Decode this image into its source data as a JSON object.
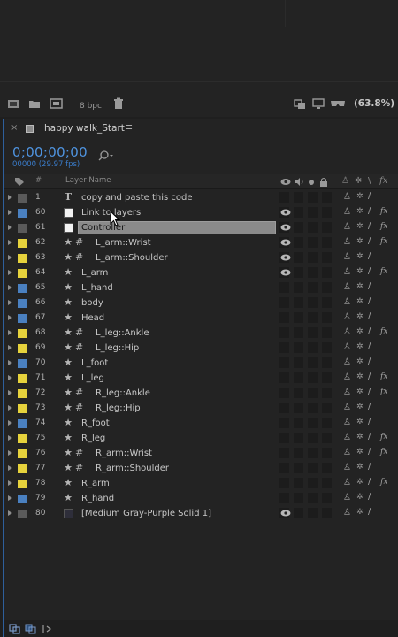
{
  "toolbar": {
    "bpc_label": "8 bpc",
    "zoom_label": "(63.8%)"
  },
  "comp_tab": {
    "close": "×",
    "name": "happy walk_Start",
    "menu": "≡"
  },
  "timecode": "0;00;00;00",
  "frame_info": "00000 (29.97 fps)",
  "columns": {
    "num": "#",
    "layer_name": "Layer Name"
  },
  "layers": [
    {
      "num": "1",
      "name": "copy and paste this code",
      "label_color": "#5a5a5a",
      "type": "text",
      "eye": false,
      "selected": false,
      "fx": false
    },
    {
      "num": "60",
      "name": "Link to layers",
      "label_color": "#4a80c0",
      "type": "solid",
      "swatch": "#f2f2f2",
      "eye": true,
      "selected": false,
      "fx": true
    },
    {
      "num": "61",
      "name": "Controller",
      "label_color": "#5a5a5a",
      "type": "solid",
      "swatch": "#f2f2f2",
      "eye": true,
      "selected": true,
      "fx": true
    },
    {
      "num": "62",
      "name": "L_arm::Wrist",
      "label_color": "#e6d23c",
      "type": "shape-null",
      "eye": true,
      "selected": false,
      "fx": true
    },
    {
      "num": "63",
      "name": "L_arm::Shoulder",
      "label_color": "#e6d23c",
      "type": "shape-null",
      "eye": true,
      "selected": false,
      "fx": false
    },
    {
      "num": "64",
      "name": "L_arm",
      "label_color": "#e6d23c",
      "type": "shape",
      "eye": true,
      "selected": false,
      "fx": true
    },
    {
      "num": "65",
      "name": "L_hand",
      "label_color": "#4a80c0",
      "type": "shape",
      "eye": false,
      "selected": false,
      "fx": false
    },
    {
      "num": "66",
      "name": "body",
      "label_color": "#4a80c0",
      "type": "shape",
      "eye": false,
      "selected": false,
      "fx": false
    },
    {
      "num": "67",
      "name": "Head",
      "label_color": "#4a80c0",
      "type": "shape",
      "eye": false,
      "selected": false,
      "fx": false
    },
    {
      "num": "68",
      "name": "L_leg::Ankle",
      "label_color": "#e6d23c",
      "type": "shape-null",
      "eye": false,
      "selected": false,
      "fx": true
    },
    {
      "num": "69",
      "name": "L_leg::Hip",
      "label_color": "#e6d23c",
      "type": "shape-null",
      "eye": false,
      "selected": false,
      "fx": false
    },
    {
      "num": "70",
      "name": "L_foot",
      "label_color": "#4a80c0",
      "type": "shape",
      "eye": false,
      "selected": false,
      "fx": false
    },
    {
      "num": "71",
      "name": "L_leg",
      "label_color": "#e6d23c",
      "type": "shape",
      "eye": false,
      "selected": false,
      "fx": true
    },
    {
      "num": "72",
      "name": "R_leg::Ankle",
      "label_color": "#e6d23c",
      "type": "shape-null",
      "eye": false,
      "selected": false,
      "fx": true
    },
    {
      "num": "73",
      "name": "R_leg::Hip",
      "label_color": "#e6d23c",
      "type": "shape-null",
      "eye": false,
      "selected": false,
      "fx": false
    },
    {
      "num": "74",
      "name": "R_foot",
      "label_color": "#4a80c0",
      "type": "shape",
      "eye": false,
      "selected": false,
      "fx": false
    },
    {
      "num": "75",
      "name": "R_leg",
      "label_color": "#e6d23c",
      "type": "shape",
      "eye": false,
      "selected": false,
      "fx": true
    },
    {
      "num": "76",
      "name": "R_arm::Wrist",
      "label_color": "#e6d23c",
      "type": "shape-null",
      "eye": false,
      "selected": false,
      "fx": true
    },
    {
      "num": "77",
      "name": "R_arm::Shoulder",
      "label_color": "#e6d23c",
      "type": "shape-null",
      "eye": false,
      "selected": false,
      "fx": false
    },
    {
      "num": "78",
      "name": "R_arm",
      "label_color": "#e6d23c",
      "type": "shape",
      "eye": false,
      "selected": false,
      "fx": true
    },
    {
      "num": "79",
      "name": "R_hand",
      "label_color": "#4a80c0",
      "type": "shape",
      "eye": false,
      "selected": false,
      "fx": false
    },
    {
      "num": "80",
      "name": "[Medium Gray-Purple Solid 1]",
      "label_color": "#5a5a5a",
      "type": "solid",
      "swatch": "#2e2e3a",
      "eye": true,
      "selected": false,
      "fx": false
    }
  ]
}
